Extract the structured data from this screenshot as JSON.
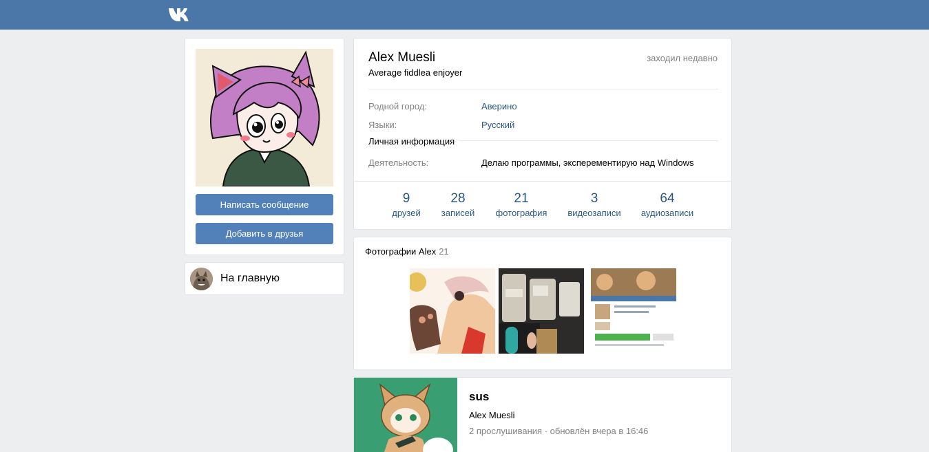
{
  "header": {
    "logo": "vk-logo"
  },
  "profile": {
    "name": "Alex Muesli",
    "online_status": "заходил недавно",
    "status": "Average fiddlea enjoyer",
    "rows": [
      {
        "label": "Родной город:",
        "value": "Аверино"
      },
      {
        "label": "Языки:",
        "value": "Русский"
      }
    ],
    "personal_section": "Личная информация",
    "activity_label": "Деятельность:",
    "activity_value": "Делаю программы, эксперементирую над Windows"
  },
  "actions": {
    "message_button": "Написать сообщение",
    "add_friend_button": "Добавить в друзья"
  },
  "home": {
    "label": "На главную"
  },
  "counters": [
    {
      "num": "9",
      "label": "друзей"
    },
    {
      "num": "28",
      "label": "записей"
    },
    {
      "num": "21",
      "label": "фотография"
    },
    {
      "num": "3",
      "label": "видеозаписи"
    },
    {
      "num": "64",
      "label": "аудиозаписи"
    }
  ],
  "photos": {
    "title": "Фотографии Alex",
    "count": "21"
  },
  "playlist": {
    "title": "sus",
    "author": "Alex Muesli",
    "meta": "2 прослушивания · обновлён вчера в 16:46"
  },
  "colors": {
    "header": "#4a76a8",
    "button": "#5181b8",
    "link": "#2a5885",
    "muted": "#828282",
    "background": "#edeef0"
  }
}
